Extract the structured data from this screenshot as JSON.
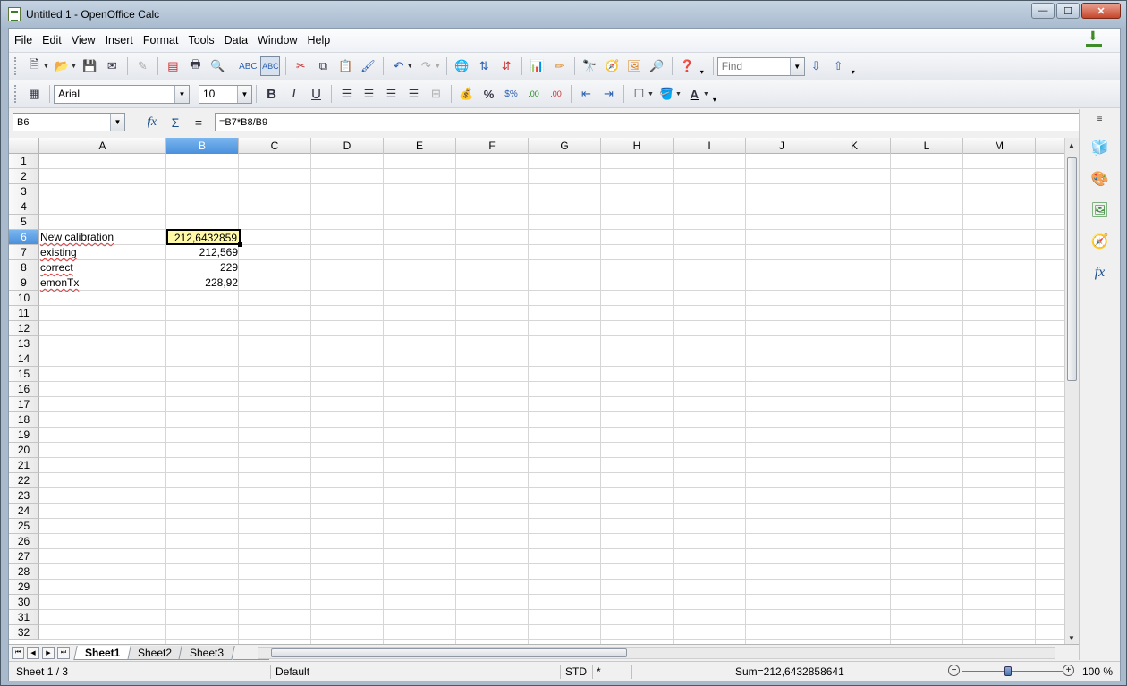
{
  "window": {
    "title": "Untitled 1 - OpenOffice Calc",
    "controls": {
      "minimize": "—",
      "maximize": "☐",
      "close": "✕"
    }
  },
  "menu": {
    "items": [
      "File",
      "Edit",
      "View",
      "Insert",
      "Format",
      "Tools",
      "Data",
      "Window",
      "Help"
    ]
  },
  "toolbar": {
    "find_placeholder": "Find"
  },
  "format_toolbar": {
    "font_name": "Arial",
    "font_size": "10",
    "bold": "B",
    "italic": "I",
    "underline": "U",
    "percent": "%"
  },
  "formula_bar": {
    "name_box": "B6",
    "formula": "=B7*B8/B9",
    "fx_icon": "fx",
    "sum_icon": "Σ",
    "equals_icon": "="
  },
  "grid": {
    "columns": [
      "A",
      "B",
      "C",
      "D",
      "E",
      "F",
      "G",
      "H",
      "I",
      "J",
      "K",
      "L",
      "M"
    ],
    "rows": [
      "1",
      "2",
      "3",
      "4",
      "5",
      "6",
      "7",
      "8",
      "9",
      "10",
      "11",
      "12",
      "13",
      "14",
      "15",
      "16",
      "17",
      "18",
      "19",
      "20",
      "21",
      "22",
      "23",
      "24",
      "25",
      "26",
      "27",
      "28",
      "29",
      "30",
      "31",
      "32"
    ],
    "selected_column": "B",
    "selected_row": "6",
    "cells": {
      "A6": "New calibration",
      "B6": "212,6432859",
      "A7": "existing",
      "B7": "212,569",
      "A8": "correct",
      "B8": "229",
      "A9": "emonTx",
      "B9": "228,92"
    }
  },
  "sheets": {
    "tabs": [
      "Sheet1",
      "Sheet2",
      "Sheet3"
    ],
    "active": "Sheet1"
  },
  "status": {
    "sheet": "Sheet 1 / 3",
    "page_style": "Default",
    "mode": "STD",
    "modified": "*",
    "sum": "Sum=212,6432858641",
    "zoom": "100 %"
  }
}
